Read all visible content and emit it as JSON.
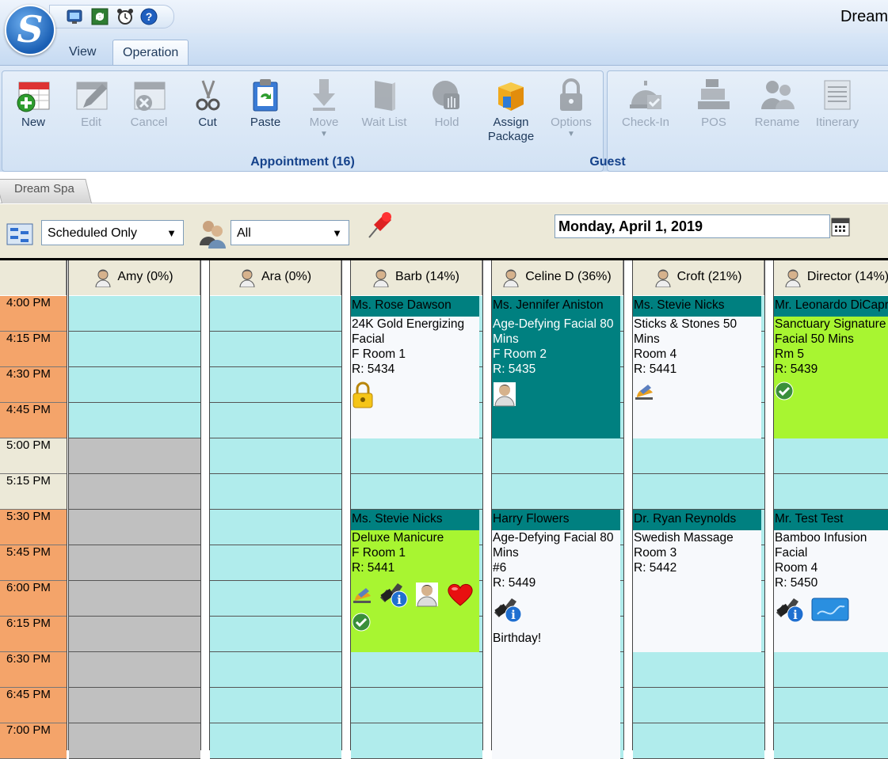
{
  "app": {
    "title": "Dream"
  },
  "ribbon_tabs": [
    {
      "label": "View"
    },
    {
      "label": "Operation"
    }
  ],
  "appointment_group": {
    "label": "Appointment (16)",
    "buttons": [
      {
        "label": "New",
        "enabled": true
      },
      {
        "label": "Edit",
        "enabled": false
      },
      {
        "label": "Cancel",
        "enabled": false
      },
      {
        "label": "Cut",
        "enabled": true
      },
      {
        "label": "Paste",
        "enabled": true
      },
      {
        "label": "Move",
        "enabled": false
      },
      {
        "label": "Wait List",
        "enabled": false
      },
      {
        "label": "Hold",
        "enabled": false
      },
      {
        "label": "Assign\nPackage",
        "enabled": true
      },
      {
        "label": "Options",
        "enabled": false
      }
    ]
  },
  "guest_group": {
    "label": "Guest",
    "buttons": [
      {
        "label": "Check-In",
        "enabled": false
      },
      {
        "label": "POS",
        "enabled": false
      },
      {
        "label": "Rename",
        "enabled": false
      },
      {
        "label": "Itinerary",
        "enabled": false
      }
    ]
  },
  "location_tab": "Dream Spa",
  "filters": {
    "schedule": "Scheduled Only",
    "staff": "All",
    "date": "Monday, April 1, 2019"
  },
  "times": [
    "4:00 PM",
    "4:15 PM",
    "4:30 PM",
    "4:45 PM",
    "5:00 PM",
    "5:15 PM",
    "5:30 PM",
    "5:45 PM",
    "6:00 PM",
    "6:15 PM",
    "6:30 PM",
    "6:45 PM",
    "7:00 PM"
  ],
  "staff": [
    {
      "name": "Amy (0%)"
    },
    {
      "name": "Ara (0%)"
    },
    {
      "name": "Barb (14%)"
    },
    {
      "name": "Celine D (36%)"
    },
    {
      "name": "Croft (21%)"
    },
    {
      "name": "Director (14%)"
    }
  ],
  "appointments": [
    {
      "guest": "Ms. Rose Dawson",
      "lines": [
        "24K Gold Energizing Facial",
        "F Room 1",
        "R: 5434"
      ],
      "icons": [
        "lock-icon"
      ],
      "color": "#f4f7fb"
    },
    {
      "guest": "Ms. Jennifer Aniston",
      "lines": [
        "Age-Defying Facial 80 Mins",
        "F Room 2",
        "R: 5435"
      ],
      "icons": [
        "staff-request-icon"
      ],
      "color": "#008080"
    },
    {
      "guest": "Ms. Stevie Nicks",
      "lines": [
        "Sticks & Stones 50 Mins",
        "Room 4",
        "R: 5441"
      ],
      "icons": [
        "service-bell-icon"
      ],
      "color": "#f4f7fb"
    },
    {
      "guest": "Mr. Leonardo DiCaprio",
      "lines": [
        "Sanctuary Signature Facial 50 Mins",
        "Rm 5",
        "R: 5439"
      ],
      "icons": [
        "checked-in-icon"
      ],
      "color": "#a8f531"
    },
    {
      "guest": "Ms. Stevie Nicks",
      "lines": [
        "Deluxe Manicure",
        "F Room 1",
        "R: 5441"
      ],
      "icons": [
        "service-bell-icon",
        "phone-info-icon",
        "staff-request-icon",
        "heart-icon",
        "checked-in-icon"
      ],
      "color": "#a8f531"
    },
    {
      "guest": "Harry Flowers",
      "lines": [
        "Age-Defying Facial 80 Mins",
        "#6",
        "R: 5449"
      ],
      "icons": [
        "phone-info-icon"
      ],
      "note": "Birthday!",
      "color": "#f4f7fb"
    },
    {
      "guest": "Dr. Ryan Reynolds",
      "lines": [
        "Swedish Massage",
        "Room 3",
        "R: 5442"
      ],
      "icons": [],
      "color": "#f4f7fb"
    },
    {
      "guest": "Mr. Test Test",
      "lines": [
        "Bamboo Infusion Facial",
        "Room 4",
        "R: 5450"
      ],
      "icons": [
        "phone-info-icon",
        "credit-card-icon"
      ],
      "color": "#f4f7fb"
    }
  ],
  "colors": {
    "open_slot": "#b0ecec",
    "off_slot": "#c0c0c0",
    "time_col": "#f4a46a",
    "header_teal": "#008080",
    "accent_green": "#a8f531"
  }
}
